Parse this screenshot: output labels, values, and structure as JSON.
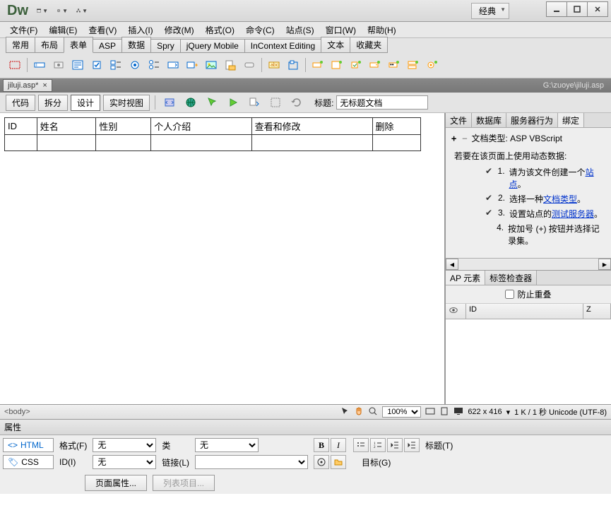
{
  "app": {
    "logo": "Dw",
    "layout_dropdown": "经典"
  },
  "menus": [
    "文件(F)",
    "编辑(E)",
    "查看(V)",
    "插入(I)",
    "修改(M)",
    "格式(O)",
    "命令(C)",
    "站点(S)",
    "窗口(W)",
    "帮助(H)"
  ],
  "ribbon_tabs": [
    "常用",
    "布局",
    "表单",
    "ASP",
    "数据",
    "Spry",
    "jQuery Mobile",
    "InContext Editing",
    "文本",
    "收藏夹"
  ],
  "ribbon_active": 2,
  "doc": {
    "tab": "jiluji.asp*",
    "path": "G:\\zuoye\\jiluji.asp"
  },
  "viewbar": {
    "buttons": [
      "代码",
      "拆分",
      "设计",
      "实时视图"
    ],
    "active": 2,
    "title_label": "标题:",
    "title_value": "无标题文档"
  },
  "table": {
    "headers": [
      "ID",
      "姓名",
      "性别",
      "个人介绍",
      "查看和修改",
      "删除"
    ]
  },
  "right_tabs": [
    "文件",
    "数据库",
    "服务器行为",
    "绑定"
  ],
  "right_active": 3,
  "binding": {
    "doctype_label": "文档类型: ASP VBScript",
    "intro": "若要在该页面上使用动态数据:",
    "steps": [
      {
        "check": true,
        "n": "1.",
        "pre": "请为该文件创建一个",
        "link": "站点",
        "post": "。"
      },
      {
        "check": true,
        "n": "2.",
        "pre": "选择一种",
        "link": "文档类型",
        "post": "。"
      },
      {
        "check": true,
        "n": "3.",
        "pre": "设置站点的",
        "link": "测试服务器",
        "post": "。"
      },
      {
        "check": false,
        "n": "4.",
        "pre": "按加号 (+) 按钮并选择记录集。",
        "link": "",
        "post": ""
      }
    ]
  },
  "ap": {
    "tabs": [
      "AP 元素",
      "标签检查器"
    ],
    "active": 0,
    "checkbox": "防止重叠",
    "cols": [
      "",
      "ID",
      "Z"
    ]
  },
  "status": {
    "tag": "<body>",
    "zoom": "100%",
    "dims": "622 x 416",
    "info": "1 K / 1 秒 Unicode (UTF-8)"
  },
  "props": {
    "title": "属性",
    "tabs": {
      "html": "HTML",
      "css": "CSS"
    },
    "format_label": "格式(F)",
    "format_value": "无",
    "class_label": "类",
    "class_value": "无",
    "id_label": "ID(I)",
    "id_value": "无",
    "link_label": "链接(L)",
    "link_value": "",
    "title_label": "标题(T)",
    "target_label": "目标(G)",
    "page_props": "页面属性...",
    "list_item": "列表项目..."
  }
}
